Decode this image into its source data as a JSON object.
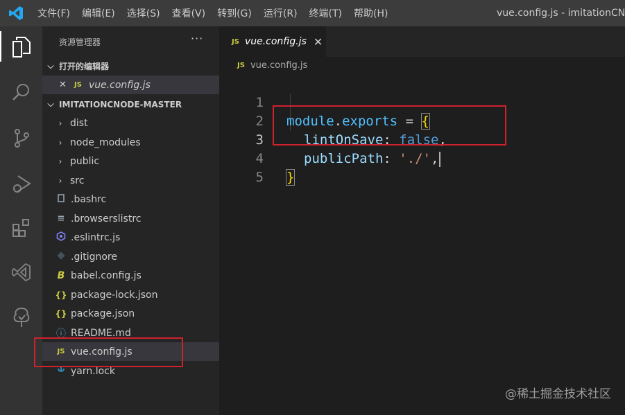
{
  "menu": {
    "items": [
      "文件(F)",
      "编辑(E)",
      "选择(S)",
      "查看(V)",
      "转到(G)",
      "运行(R)",
      "终端(T)",
      "帮助(H)"
    ],
    "window_title": "vue.config.js - imitationCN"
  },
  "activity_icons": [
    "explorer-icon",
    "search-icon",
    "source-control-icon",
    "run-debug-icon",
    "extensions-icon",
    "visual-studio-icon",
    "tree-icon"
  ],
  "sidebar": {
    "title": "资源管理器",
    "more": "···",
    "open_editors": {
      "label": "打开的编辑器",
      "items": [
        {
          "close": "✕",
          "icon": "JS",
          "name": "vue.config.js"
        }
      ]
    },
    "project": {
      "label": "IMITATIONCNODE-MASTER",
      "folders": [
        "dist",
        "node_modules",
        "public",
        "src"
      ],
      "files": [
        {
          "name": ".bashrc",
          "icon": "file-icon"
        },
        {
          "name": ".browserslistrc",
          "icon": "lines-icon"
        },
        {
          "name": ".eslintrc.js",
          "icon": "eslint-icon"
        },
        {
          "name": ".gitignore",
          "icon": "git-icon"
        },
        {
          "name": "babel.config.js",
          "icon": "babel-icon",
          "glyph": "B"
        },
        {
          "name": "package-lock.json",
          "icon": "json-icon",
          "glyph": "{}"
        },
        {
          "name": "package.json",
          "icon": "json-icon",
          "glyph": "{}"
        },
        {
          "name": "README.md",
          "icon": "info-icon",
          "glyph": "ⓘ"
        },
        {
          "name": "vue.config.js",
          "icon": "js-icon",
          "glyph": "JS",
          "selected": true
        },
        {
          "name": "yarn.lock",
          "icon": "yarn-icon"
        }
      ]
    }
  },
  "editor": {
    "tab": {
      "icon": "JS",
      "name": "vue.config.js",
      "close": "✕"
    },
    "breadcrumb": {
      "icon": "JS",
      "name": "vue.config.js"
    },
    "line_numbers": [
      "1",
      "2",
      "3",
      "4",
      "5"
    ],
    "code": {
      "l1": {
        "id": "module",
        "dot": ".",
        "prop": "exports",
        "eq": " = ",
        "brace": "{"
      },
      "l2": {
        "key": "lintOnSave",
        "colon": ": ",
        "val": "false",
        "comma": ","
      },
      "l3": {
        "key": "publicPath",
        "colon": ": ",
        "val": "'./'",
        "comma": ","
      },
      "l4": {
        "brace": "}"
      }
    }
  },
  "watermark": "@稀土掘金技术社区",
  "colors": {
    "highlight_box": "#d0222d",
    "js_icon": "#cbcb41",
    "keyword": "#569cd6",
    "string": "#ce9178",
    "property": "#9cdcfe"
  }
}
